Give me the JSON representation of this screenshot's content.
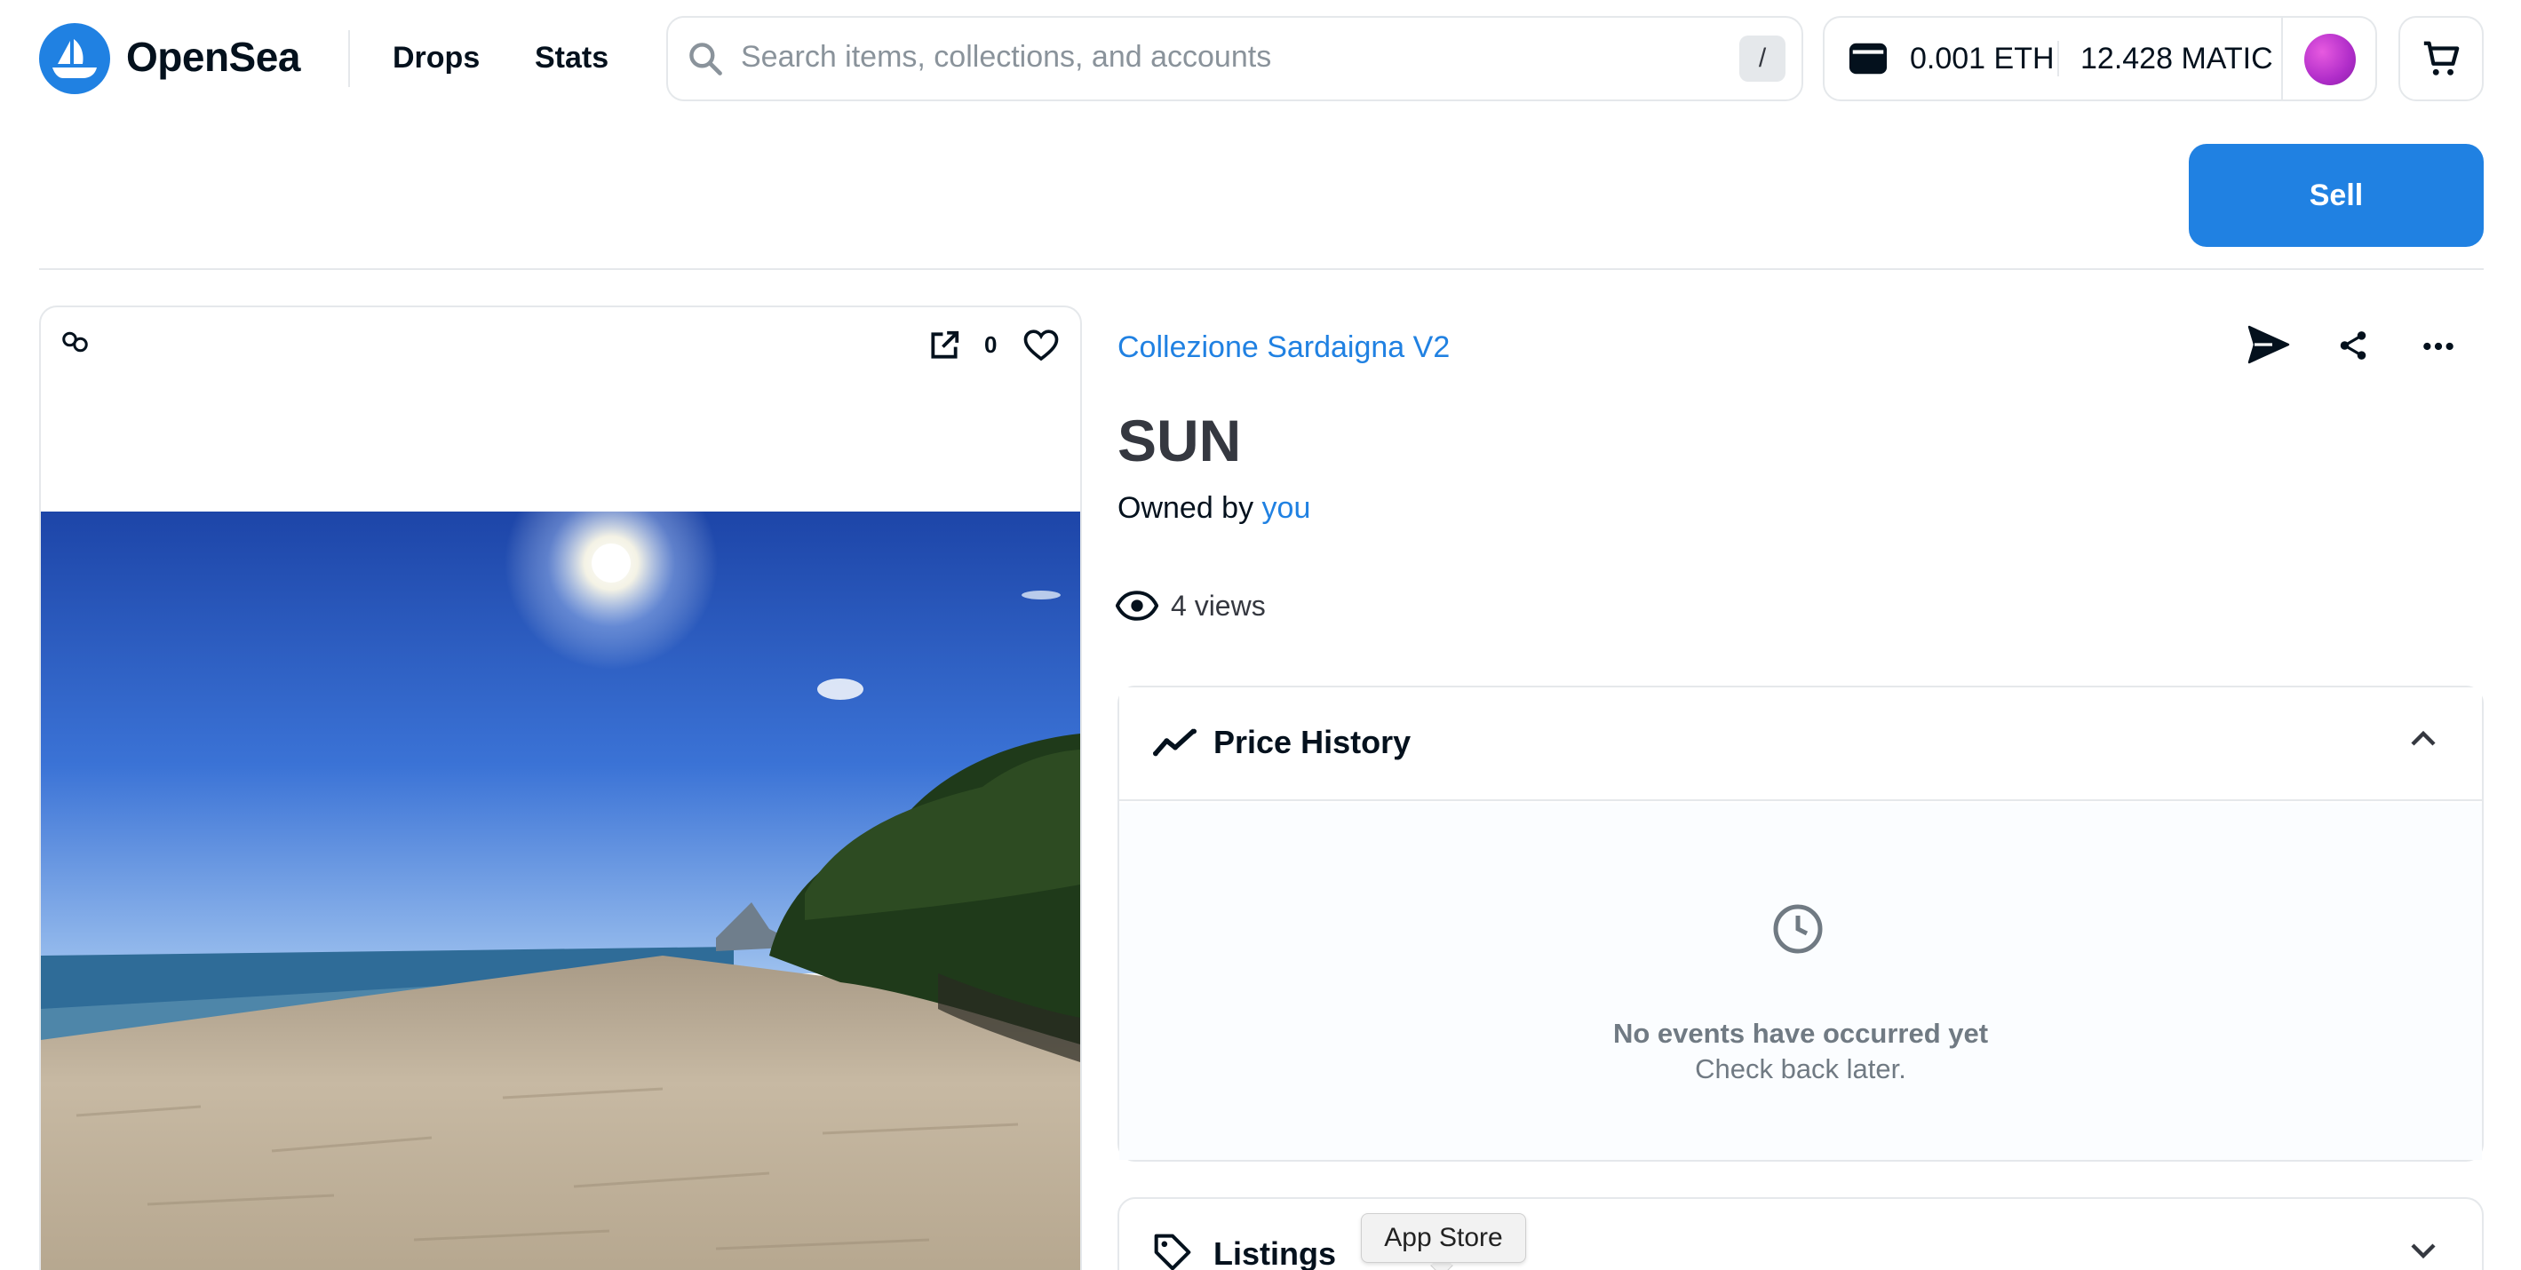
{
  "header": {
    "brand": "OpenSea",
    "nav": [
      "Drops",
      "Stats"
    ],
    "search": {
      "placeholder": "Search items, collections, and accounts",
      "value": "",
      "shortcut": "/"
    },
    "wallet": {
      "eth_balance": "0.001 ETH",
      "matic_balance": "12.428 MATIC"
    },
    "icons": {
      "logo": "opensea-ship-icon",
      "search": "search-icon",
      "wallet": "wallet-icon",
      "avatar": "avatar",
      "cart": "cart-icon"
    }
  },
  "actions": {
    "sell_label": "Sell"
  },
  "media": {
    "favorites_count": "0",
    "icons": [
      "chain-icon",
      "external-link-icon",
      "heart-icon"
    ],
    "image_subject": "beach-photo"
  },
  "item": {
    "collection": "Collezione Sardaigna V2",
    "title": "SUN",
    "owned_by_prefix": "Owned by",
    "owner": "you",
    "views": "4 views",
    "icons": [
      "send-icon",
      "share-icon",
      "more-icon",
      "eye-icon"
    ]
  },
  "price_history": {
    "title": "Price History",
    "empty_title": "No events have occurred yet",
    "empty_subtitle": "Check back later.",
    "expanded": true
  },
  "listings": {
    "title": "Listings",
    "expanded": false
  },
  "tooltip": {
    "text": "App Store"
  },
  "colors": {
    "accent": "#2081e2",
    "border": "#e5e8eb",
    "text": "#04111d",
    "muted": "#707a83"
  }
}
